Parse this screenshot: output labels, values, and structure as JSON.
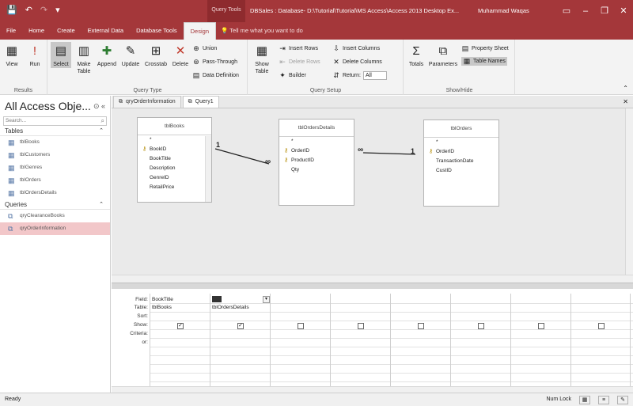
{
  "titlebar": {
    "save_icon": "save-icon",
    "undo_icon": "undo-icon",
    "context_tab": "Query Tools",
    "title": "DBSales : Database- D:\\Tutorial\\Tutorial\\MS Access\\Access 2013 Desktop Ex...",
    "user": "Muhammad Waqas",
    "accent": "#a4373a"
  },
  "tabs": [
    "File",
    "Home",
    "Create",
    "External Data",
    "Database Tools",
    "Design"
  ],
  "tell_me": "Tell me what you want to do",
  "ribbon": {
    "results": {
      "label": "Results",
      "view": "View",
      "run": "Run"
    },
    "query_type": {
      "label": "Query Type",
      "select": "Select",
      "make_table": "Make Table",
      "append": "Append",
      "update": "Update",
      "crosstab": "Crosstab",
      "delete": "Delete",
      "union": "Union",
      "pass_through": "Pass-Through",
      "data_definition": "Data Definition"
    },
    "query_setup": {
      "label": "Query Setup",
      "show_table": "Show Table",
      "insert_rows": "Insert Rows",
      "delete_rows": "Delete Rows",
      "builder": "Builder",
      "insert_columns": "Insert Columns",
      "delete_columns": "Delete Columns",
      "return_label": "Return:",
      "return_value": "All"
    },
    "show_hide": {
      "label": "Show/Hide",
      "totals": "Totals",
      "parameters": "Parameters",
      "property_sheet": "Property Sheet",
      "table_names": "Table Names"
    }
  },
  "nav": {
    "title": "All Access Obje...",
    "search_placeholder": "Search...",
    "tables_header": "Tables",
    "tables": [
      "tblBooks",
      "tblCustomers",
      "tblGenres",
      "tblOrders",
      "tblOrdersDetails"
    ],
    "queries_header": "Queries",
    "queries": [
      "qryClearanceBooks",
      "qryOrderInformation"
    ]
  },
  "doc_tabs": [
    "qryOrderInformation",
    "Query1"
  ],
  "design": {
    "tables": [
      {
        "name": "tblBooks",
        "fields": [
          {
            "name": "*",
            "key": false
          },
          {
            "name": "BookID",
            "key": true
          },
          {
            "name": "BookTitle",
            "key": false
          },
          {
            "name": "Description",
            "key": false
          },
          {
            "name": "GenreID",
            "key": false
          },
          {
            "name": "RetailPrice",
            "key": false
          }
        ]
      },
      {
        "name": "tblOrdersDetails",
        "fields": [
          {
            "name": "*",
            "key": false
          },
          {
            "name": "OrderID",
            "key": true
          },
          {
            "name": "ProductID",
            "key": true
          },
          {
            "name": "Qty",
            "key": false
          }
        ]
      },
      {
        "name": "tblOrders",
        "fields": [
          {
            "name": "*",
            "key": false
          },
          {
            "name": "OrderID",
            "key": true
          },
          {
            "name": "TransactionDate",
            "key": false
          },
          {
            "name": "CustID",
            "key": false
          }
        ]
      }
    ],
    "relationship_markers": {
      "one": "1",
      "many": "∞"
    }
  },
  "grid": {
    "row_labels": [
      "Field:",
      "Table:",
      "Sort:",
      "Show:",
      "Criteria:",
      "or:"
    ],
    "columns": [
      {
        "field": "BookTitle",
        "table": "tblBooks",
        "show": true
      },
      {
        "field": "",
        "table": "tblOrdersDetails",
        "show": true
      },
      {
        "field": "",
        "table": "",
        "show": false
      },
      {
        "field": "",
        "table": "",
        "show": false
      },
      {
        "field": "",
        "table": "",
        "show": false
      },
      {
        "field": "",
        "table": "",
        "show": false
      },
      {
        "field": "",
        "table": "",
        "show": false
      },
      {
        "field": "",
        "table": "",
        "show": false
      }
    ]
  },
  "status": {
    "left": "Ready",
    "num_lock": "Num Lock"
  }
}
